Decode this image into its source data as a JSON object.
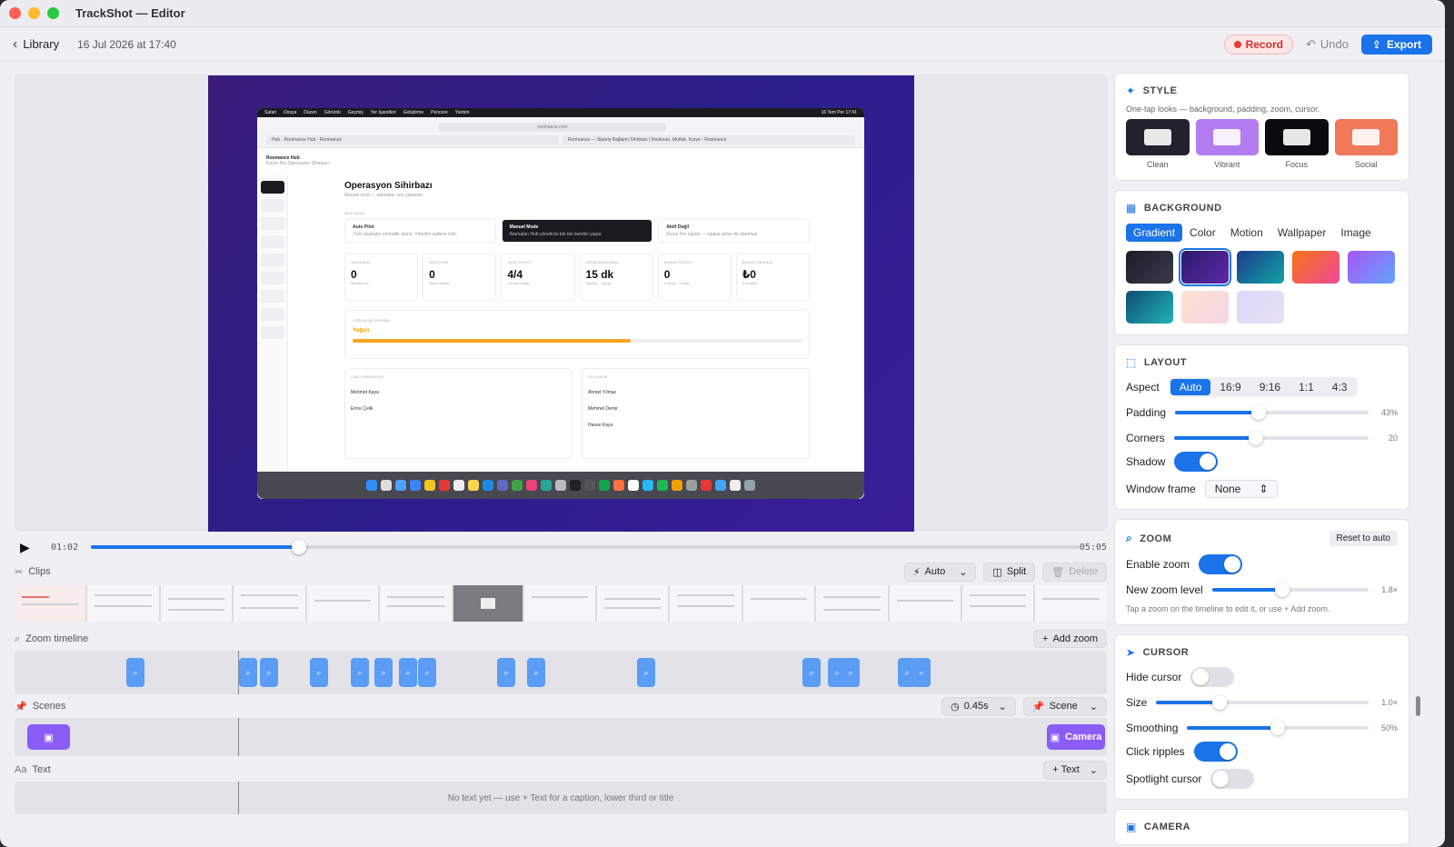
{
  "window": {
    "title": "TrackShot — Editor"
  },
  "toolbar": {
    "back_label": "Library",
    "date": "16 Jul 2026 at 17:40",
    "record_label": "Record",
    "undo_label": "Undo",
    "export_label": "Export"
  },
  "preview": {
    "menubar": [
      "Safari",
      "Dosya",
      "Düzen",
      "Görüntü",
      "Geçmiş",
      "Yer İşaretleri",
      "Geliştirme",
      "Pencere",
      "Yardım"
    ],
    "clock": "16 Tem Per 17:41",
    "url": "roomance.com",
    "tabs": [
      "Hub · Roomance Hub · Roomance",
      "Roomance — Sipariş Bağlantı Sihirbazı | Restoran, Mutfak, Kurye · Roomance"
    ],
    "app_name": "Roomance Hub",
    "app_sub": "Kurye Per Operasyon Sihirbazı",
    "heading": "Operasyon Sihirbazı",
    "subheading": "Manuel mod — atamaları sen yaparsın",
    "mode_label": "MOD MODU",
    "modes": [
      {
        "title": "Auto Pilot",
        "desc": "Tüm siparişler otomatik atanır. Yönetici sadece izler."
      },
      {
        "title": "Manuel Mode",
        "desc": "Atamaları Hub yöneticisi tek tek kendisi yapar."
      },
      {
        "title": "Aktif Değil",
        "desc": "Kurye Per kapalı — sipariş gelse de atanmaz"
      }
    ],
    "stats": [
      {
        "label": "YAKLAŞAN",
        "value": "0",
        "sub": "Mutfak boş"
      },
      {
        "label": "BEKLEYEN",
        "value": "0",
        "sub": "Hepsi atandı"
      },
      {
        "label": "AKTİF KURYE",
        "value": "4/4",
        "sub": "4 kurye yolda"
      },
      {
        "label": "ORTALAMA ATAMA",
        "value": "15 dk",
        "sub": "Sipariş → kurye"
      },
      {
        "label": "BUGÜN TESLİM",
        "value": "0",
        "sub": "0 kurye · 4 aktif"
      },
      {
        "label": "BUGÜN TAHSİLAT",
        "value": "₺0",
        "sub": "0 tahsilat"
      }
    ],
    "load_label": "YOĞUNLUK DURUMU",
    "load_value": "Yoğun",
    "load_level": 0.62,
    "lists": [
      {
        "title": "CANLI SİPARİŞLER",
        "rows": [
          "Mehmet Kaya",
          "Emre Çelik"
        ]
      },
      {
        "title": "FİLO ANLIK",
        "rows": [
          "Ahmet Yılmaz",
          "Mehmet Demir",
          "Hasan Kaya"
        ]
      }
    ]
  },
  "playback": {
    "current_time": "01:02",
    "end_time": "05:05",
    "progress": 0.21
  },
  "clips": {
    "label": "Clips",
    "auto_label": "Auto",
    "split_label": "Split",
    "delete_label": "Delete"
  },
  "zoom_timeline": {
    "label": "Zoom timeline",
    "add_label": "Add zoom"
  },
  "scenes": {
    "label": "Scenes",
    "duration_label": "0.45s",
    "scene_label": "Scene",
    "camera_label": "Camera"
  },
  "text_track": {
    "label": "Text",
    "add_label": "+ Text",
    "empty_message": "No text yet — use + Text for a caption, lower third or title"
  },
  "style": {
    "title": "STYLE",
    "description": "One-tap looks — background, padding, zoom, cursor.",
    "presets": [
      {
        "name": "Clean",
        "color": "#22222e"
      },
      {
        "name": "Vibrant",
        "color": "#b37cf0"
      },
      {
        "name": "Focus",
        "color": "#0b0b0e"
      },
      {
        "name": "Social",
        "color": "#f0795a"
      }
    ]
  },
  "background": {
    "title": "BACKGROUND",
    "tabs": [
      "Gradient",
      "Color",
      "Motion",
      "Wallpaper",
      "Image"
    ],
    "active_tab": "Gradient"
  },
  "layout": {
    "title": "LAYOUT",
    "aspect_label": "Aspect",
    "aspects": [
      "Auto",
      "16:9",
      "9:16",
      "1:1",
      "4:3"
    ],
    "padding_label": "Padding",
    "padding_value": "43%",
    "padding_level": 0.43,
    "corners_label": "Corners",
    "corners_value": "20",
    "corners_level": 0.42,
    "shadow_label": "Shadow",
    "frame_label": "Window frame",
    "frame_value": "None"
  },
  "zoom": {
    "title": "ZOOM",
    "reset_label": "Reset to auto",
    "enable_label": "Enable zoom",
    "level_label": "New zoom level",
    "level_value": "1.8×",
    "level_fraction": 0.45,
    "hint": "Tap a zoom on the timeline to edit it, or use + Add zoom."
  },
  "cursor": {
    "title": "CURSOR",
    "hide_label": "Hide cursor",
    "size_label": "Size",
    "size_value": "1.0×",
    "size_level": 0.3,
    "smoothing_label": "Smoothing",
    "smoothing_value": "50%",
    "smoothing_level": 0.5,
    "ripples_label": "Click ripples",
    "spotlight_label": "Spotlight cursor"
  },
  "camera": {
    "title": "CAMERA"
  }
}
